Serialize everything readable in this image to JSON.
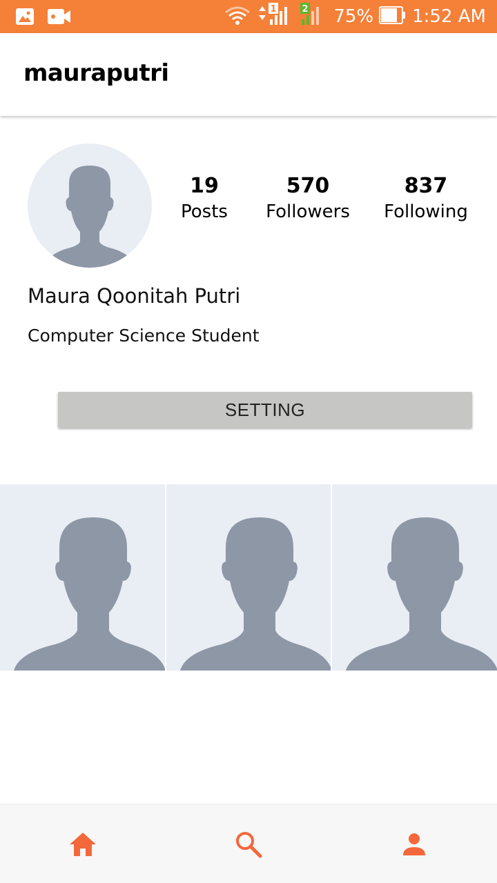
{
  "status_bar": {
    "battery": "75%",
    "time": "1:52 AM",
    "sim1_label": "1",
    "sim2_label": "2"
  },
  "app_bar": {
    "title": "mauraputri"
  },
  "profile": {
    "stats": [
      {
        "value": "19",
        "label": "Posts"
      },
      {
        "value": "570",
        "label": "Followers"
      },
      {
        "value": "837",
        "label": "Following"
      }
    ],
    "full_name": "Maura Qoonitah Putri",
    "bio": "Computer Science Student",
    "setting_label": "SETTING"
  },
  "posts_grid": {
    "items": [
      "placeholder-avatar",
      "placeholder-avatar",
      "placeholder-avatar"
    ]
  },
  "bottom_nav": {
    "items": [
      "home-icon",
      "search-icon",
      "person-icon"
    ]
  },
  "colors": {
    "accent": "#f58038",
    "nav_icon": "#f4673b",
    "placeholder_bg": "#e9edf4",
    "placeholder_figure": "#8e97a6",
    "button_bg": "#c6c6c4"
  }
}
